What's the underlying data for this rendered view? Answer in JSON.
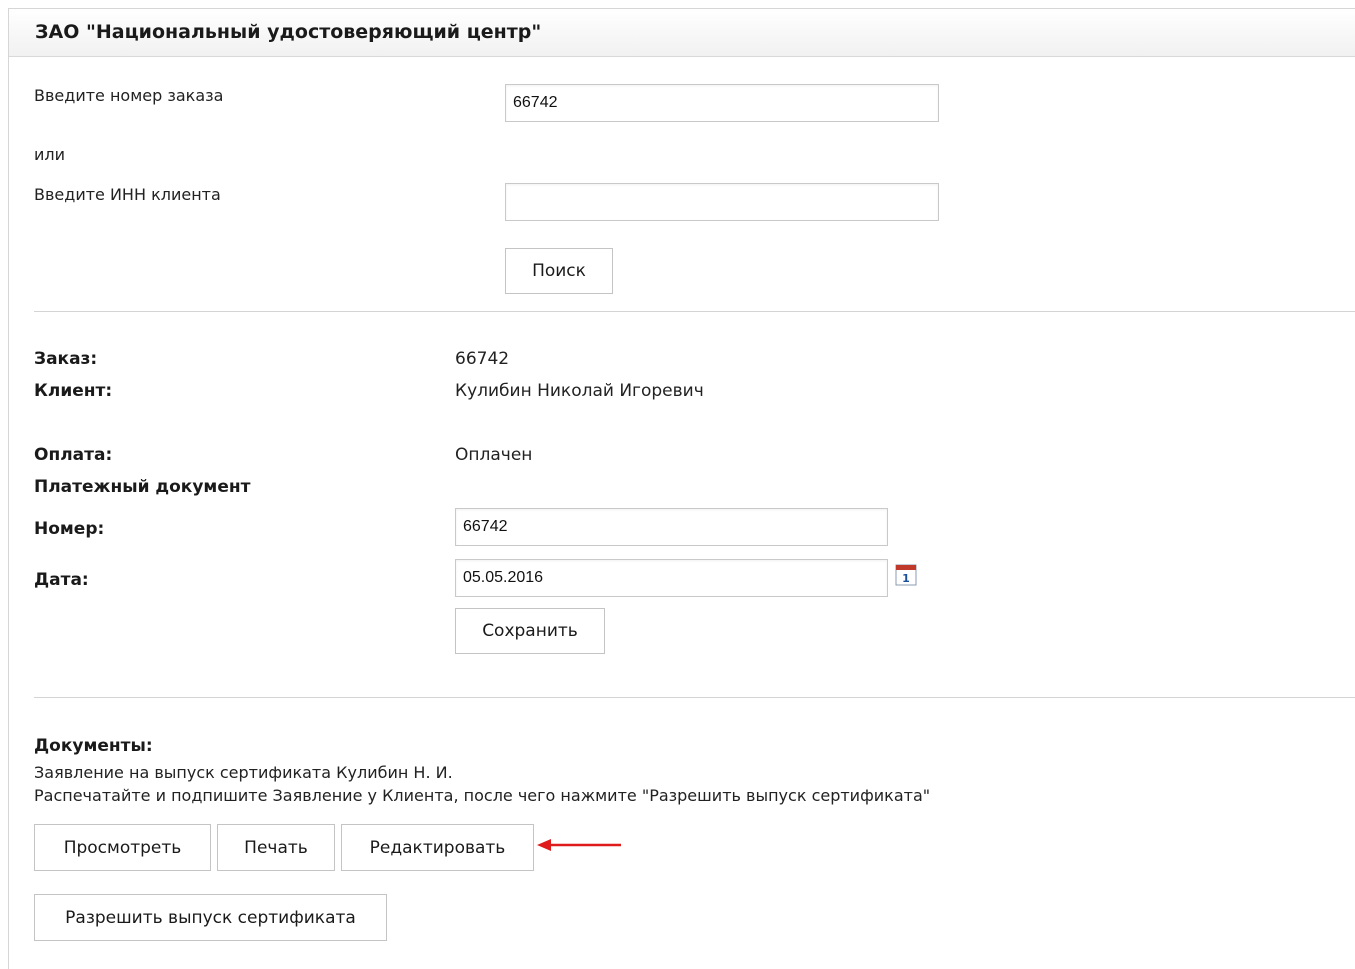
{
  "header": {
    "title": "ЗАО \"Национальный удостоверяющий центр\""
  },
  "search": {
    "order_label": "Введите номер заказа",
    "order_value": "66742",
    "or_label": "или",
    "inn_label": "Введите ИНН клиента",
    "inn_value": "",
    "search_button": "Поиск"
  },
  "order": {
    "order_label": "Заказ:",
    "order_value": "66742",
    "client_label": "Клиент:",
    "client_value": "Кулибин Николай Игоревич",
    "payment_label": "Оплата:",
    "payment_value": "Оплачен",
    "payment_doc_heading": "Платежный документ",
    "number_label": "Номер:",
    "number_value": "66742",
    "date_label": "Дата:",
    "date_value": "05.05.2016",
    "calendar_icon": "calendar-icon",
    "calendar_day": "1",
    "save_button": "Сохранить"
  },
  "documents": {
    "heading": "Документы:",
    "line1": "Заявление на выпуск сертификата Кулибин Н. И.",
    "line2": "Распечатайте и подпишите Заявление у Клиента, после чего нажмите \"Разрешить выпуск сертификата\"",
    "view_button": "Просмотреть",
    "print_button": "Печать",
    "edit_button": "Редактировать",
    "allow_button": "Разрешить выпуск сертификата",
    "arrow_icon": "arrow-left-icon",
    "arrow_color": "#e01b1b"
  }
}
